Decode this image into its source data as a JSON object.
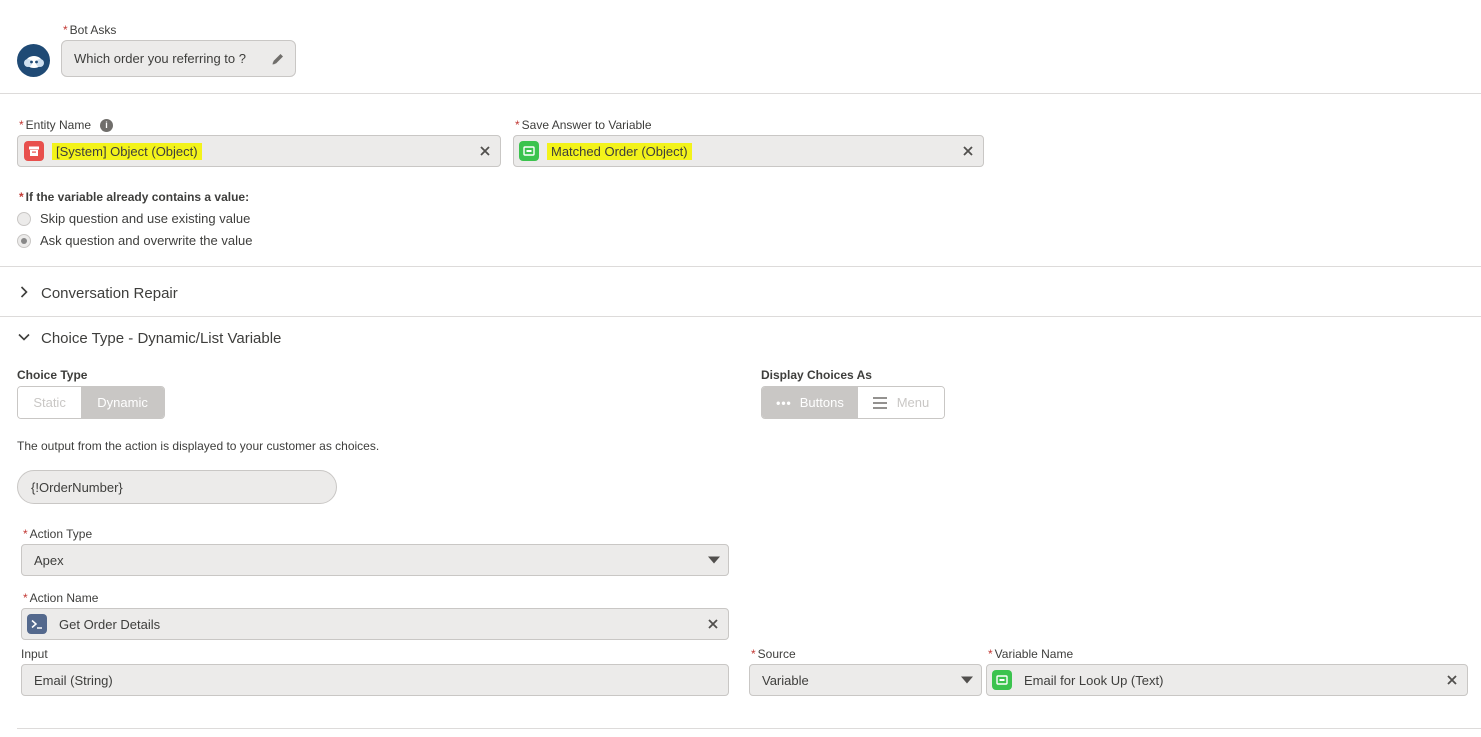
{
  "bot_asks": {
    "label": "Bot Asks",
    "value": "Which order you referring to ?"
  },
  "entity": {
    "label": "Entity Name",
    "value": "[System] Object (Object)"
  },
  "save_answer": {
    "label": "Save Answer to Variable",
    "value": "Matched Order (Object)"
  },
  "variable_value": {
    "label": "If the variable already contains a value:",
    "options": [
      "Skip question and use existing value",
      "Ask question and overwrite the value"
    ],
    "selected": "Ask question and overwrite the value"
  },
  "sections": {
    "conversation_repair": "Conversation Repair",
    "choice_type": "Choice Type - Dynamic/List Variable"
  },
  "choice_type": {
    "label": "Choice Type",
    "options": [
      "Static",
      "Dynamic"
    ],
    "selected": "Dynamic"
  },
  "display_choices": {
    "label": "Display Choices As",
    "options": [
      "Buttons",
      "Menu"
    ],
    "selected": "Buttons"
  },
  "help_text": "The output from the action is displayed to your customer as choices.",
  "output_pill": "{!OrderNumber}",
  "action_type": {
    "label": "Action Type",
    "value": "Apex"
  },
  "action_name": {
    "label": "Action Name",
    "value": "Get Order Details"
  },
  "input": {
    "label": "Input",
    "value": "Email (String)"
  },
  "source": {
    "label": "Source",
    "value": "Variable"
  },
  "variable_name": {
    "label": "Variable Name",
    "value": "Email for Look Up (Text)"
  },
  "colors": {
    "highlight": "#f3f31a",
    "required": "#c23934",
    "entity_icon": "#e8504d",
    "variable_icon": "#3bc34e",
    "apex_icon": "#54698d",
    "bot_avatar": "#1f4a75"
  },
  "icons": [
    "bot-avatar-icon",
    "pencil-icon",
    "info-icon",
    "entity-icon",
    "variable-icon",
    "close-icon",
    "chevron-right-icon",
    "chevron-down-icon",
    "ellipsis-icon",
    "list-icon",
    "apex-icon",
    "dropdown-caret-icon"
  ]
}
